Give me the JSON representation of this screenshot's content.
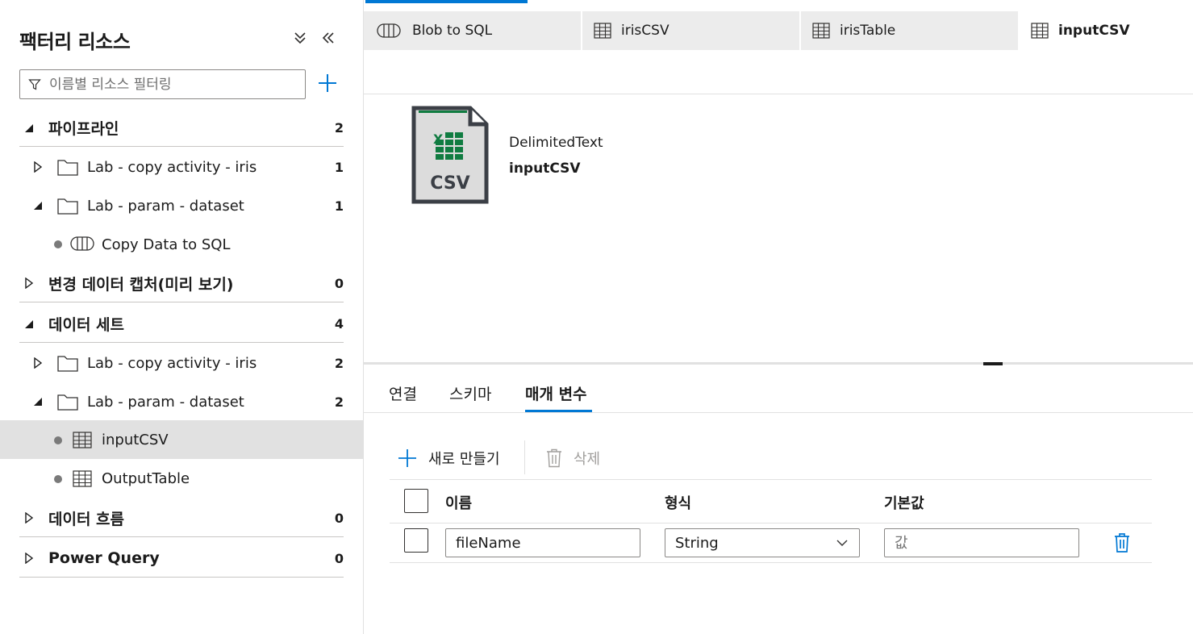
{
  "left_panel": {
    "title": "팩터리 리소스",
    "filter_placeholder": "이름별 리소스 필터링",
    "sections": {
      "pipelines": {
        "label": "파이프라인",
        "count": "2",
        "folders": [
          {
            "label": "Lab - copy activity - iris",
            "count": "1"
          },
          {
            "label": "Lab - param - dataset",
            "count": "1",
            "items": [
              "Copy Data to SQL"
            ]
          }
        ]
      },
      "cdc": {
        "label": "변경 데이터 캡처(미리 보기)",
        "count": "0"
      },
      "datasets": {
        "label": "데이터 세트",
        "count": "4",
        "folders": [
          {
            "label": "Lab - copy activity - iris",
            "count": "2"
          },
          {
            "label": "Lab - param - dataset",
            "count": "2",
            "items": [
              "inputCSV",
              "OutputTable"
            ]
          }
        ]
      },
      "dataflows": {
        "label": "데이터 흐름",
        "count": "0"
      },
      "powerquery": {
        "label": "Power Query",
        "count": "0"
      }
    }
  },
  "tabs": [
    {
      "label": "Blob to SQL",
      "icon": "pipeline-icon"
    },
    {
      "label": "irisCSV",
      "icon": "table-icon"
    },
    {
      "label": "irisTable",
      "icon": "table-icon"
    },
    {
      "label": "inputCSV",
      "icon": "table-icon",
      "active": true
    }
  ],
  "dataset": {
    "icon_label": "CSV",
    "type": "DelimitedText",
    "name": "inputCSV"
  },
  "subtabs": [
    "연결",
    "스키마",
    "매개 변수"
  ],
  "toolbar": {
    "new_label": "새로 만들기",
    "delete_label": "삭제"
  },
  "params_table": {
    "headers": [
      "이름",
      "형식",
      "기본값"
    ],
    "rows": [
      {
        "name": "fileName",
        "type": "String",
        "default_placeholder": "값"
      }
    ]
  },
  "colors": {
    "accent": "#0078d4",
    "selected_row": "#e1e1e1",
    "excel_green": "#107c41"
  }
}
